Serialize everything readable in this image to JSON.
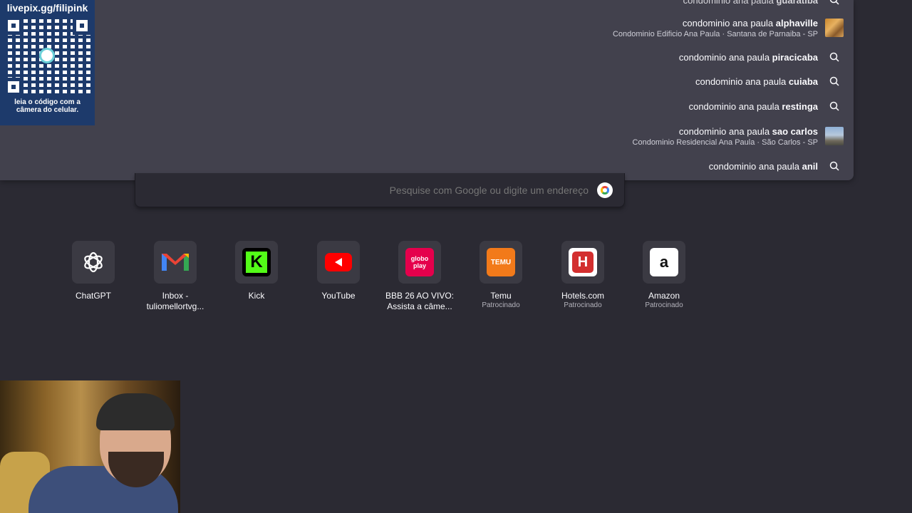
{
  "overlays": {
    "qr_url": "livepix.gg/filipink",
    "qr_caption_line1": "leia o código com a",
    "qr_caption_line2": "câmera do celular."
  },
  "suggestions": [
    {
      "prefix": "condominio ana paula ",
      "bold": "alphaville",
      "sub": "Condominio Edificio Ana Paula · Santana de Parnaiba - SP",
      "icon": "building-thumbnail"
    },
    {
      "prefix": "condominio ana paula ",
      "bold": "piracicaba",
      "icon": "search-icon"
    },
    {
      "prefix": "condominio ana paula ",
      "bold": "cuiaba",
      "icon": "search-icon"
    },
    {
      "prefix": "condominio ana paula ",
      "bold": "restinga",
      "icon": "search-icon"
    },
    {
      "prefix": "condominio ana paula ",
      "bold": "sao carlos",
      "sub": "Condominio Residencial Ana Paula · São Carlos - SP",
      "icon": "building-thumbnail"
    },
    {
      "prefix": "condominio ana paula ",
      "bold": "anil",
      "icon": "search-icon"
    }
  ],
  "search": {
    "placeholder": "Pesquise com Google ou digite um endereço",
    "engine_icon": "google-icon"
  },
  "shortcuts": [
    {
      "label": "Amazon",
      "sponsored": "Patrocinado",
      "icon": "amazon-icon",
      "color": "#ffffff"
    },
    {
      "label": "Hotels.com",
      "sponsored": "Patrocinado",
      "icon": "hotels-icon",
      "color": "#d32f2f"
    },
    {
      "label": "Temu",
      "sponsored": "Patrocinado",
      "icon": "temu-icon",
      "color": "#f27a1a"
    },
    {
      "label": "BBB 26 AO VIVO:",
      "label2": "Assista a câme...",
      "icon": "globoplay-icon",
      "color": "#e5004c"
    },
    {
      "label": "YouTube",
      "icon": "youtube-icon",
      "color": "#ff0000"
    },
    {
      "label": "Kick",
      "icon": "kick-icon",
      "color": "#53fc18"
    },
    {
      "label": "Inbox -",
      "label2": "tuliomellortvg...",
      "icon": "gmail-icon",
      "color": "#ea4335"
    },
    {
      "label": "ChatGPT",
      "icon": "chatgpt-icon",
      "color": "#ffffff"
    }
  ]
}
